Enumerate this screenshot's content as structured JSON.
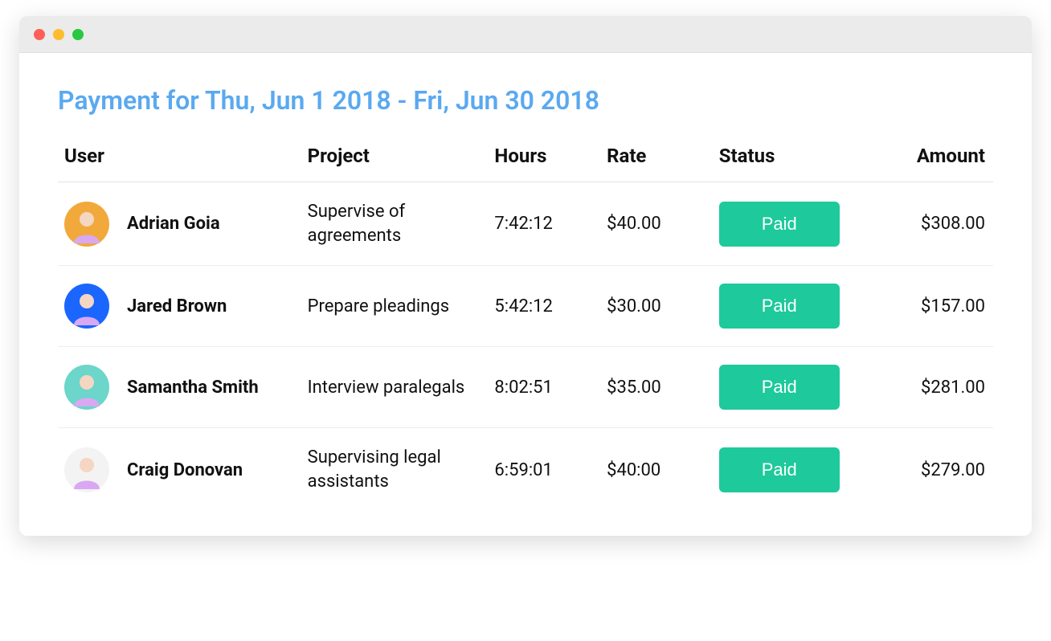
{
  "title": "Payment for Thu, Jun 1 2018 - Fri, Jun 30 2018",
  "columns": {
    "user": "User",
    "project": "Project",
    "hours": "Hours",
    "rate": "Rate",
    "status": "Status",
    "amount": "Amount"
  },
  "rows": [
    {
      "user": "Adrian Goia",
      "avatar_bg": "#f2a93b",
      "project": "Supervise of agreements",
      "hours": "7:42:12",
      "rate": "$40.00",
      "status": "Paid",
      "amount": "$308.00"
    },
    {
      "user": "Jared Brown",
      "avatar_bg": "#1a66ff",
      "project": "Prepare pleadings",
      "hours": "5:42:12",
      "rate": "$30.00",
      "status": "Paid",
      "amount": "$157.00"
    },
    {
      "user": "Samantha Smith",
      "avatar_bg": "#6bd6c9",
      "project": "Interview paralegals",
      "hours": "8:02:51",
      "rate": "$35.00",
      "status": "Paid",
      "amount": "$281.00"
    },
    {
      "user": "Craig Donovan",
      "avatar_bg": "#f3f3f3",
      "project": "Supervising legal assistants",
      "hours": "6:59:01",
      "rate": "$40:00",
      "status": "Paid",
      "amount": "$279.00"
    }
  ],
  "colors": {
    "accent": "#5aa9f0",
    "status_badge": "#1ec99b"
  }
}
